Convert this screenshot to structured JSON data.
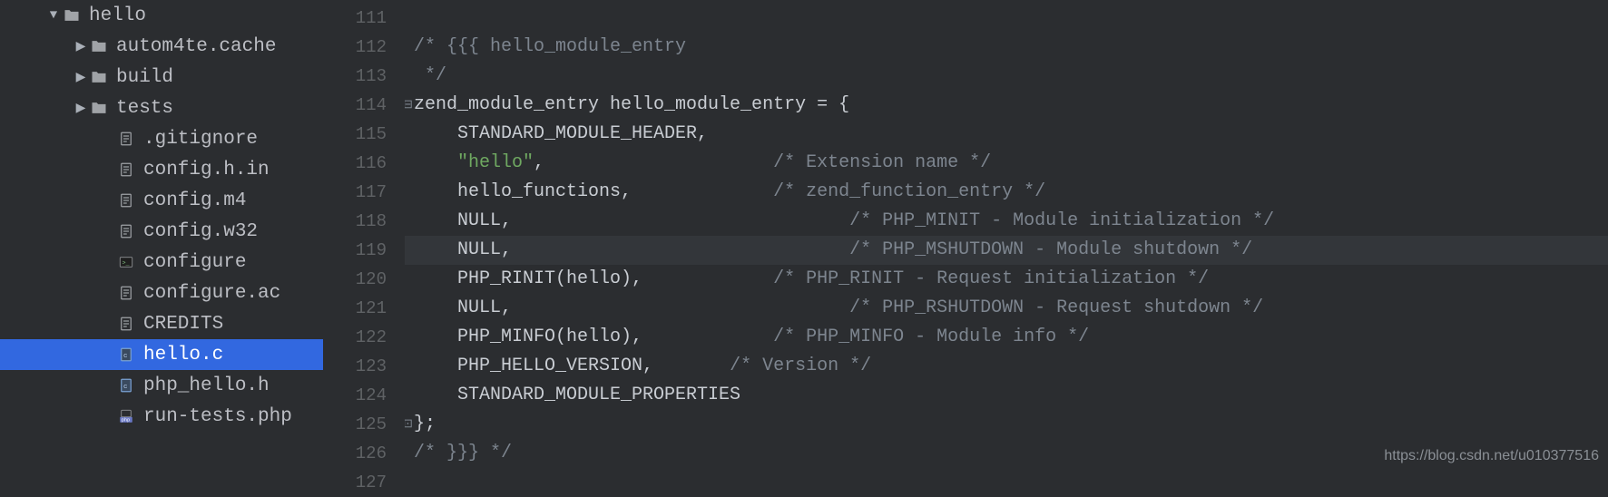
{
  "sidebar": {
    "items": [
      {
        "label": "hello",
        "depth": 1,
        "arrow": "down",
        "icon": "folder",
        "selected": false
      },
      {
        "label": "autom4te.cache",
        "depth": 2,
        "arrow": "right",
        "icon": "folder",
        "selected": false
      },
      {
        "label": "build",
        "depth": 2,
        "arrow": "right",
        "icon": "folder",
        "selected": false
      },
      {
        "label": "tests",
        "depth": 2,
        "arrow": "right",
        "icon": "folder",
        "selected": false
      },
      {
        "label": ".gitignore",
        "depth": 3,
        "arrow": "",
        "icon": "file",
        "selected": false
      },
      {
        "label": "config.h.in",
        "depth": 3,
        "arrow": "",
        "icon": "file",
        "selected": false
      },
      {
        "label": "config.m4",
        "depth": 3,
        "arrow": "",
        "icon": "file",
        "selected": false
      },
      {
        "label": "config.w32",
        "depth": 3,
        "arrow": "",
        "icon": "file",
        "selected": false
      },
      {
        "label": "configure",
        "depth": 3,
        "arrow": "",
        "icon": "term",
        "selected": false
      },
      {
        "label": "configure.ac",
        "depth": 3,
        "arrow": "",
        "icon": "file",
        "selected": false
      },
      {
        "label": "CREDITS",
        "depth": 3,
        "arrow": "",
        "icon": "file",
        "selected": false
      },
      {
        "label": "hello.c",
        "depth": 3,
        "arrow": "",
        "icon": "cfile",
        "selected": true
      },
      {
        "label": "php_hello.h",
        "depth": 3,
        "arrow": "",
        "icon": "cfile",
        "selected": false
      },
      {
        "label": "run-tests.php",
        "depth": 3,
        "arrow": "",
        "icon": "php",
        "selected": false
      }
    ]
  },
  "gutter": {
    "start": 111,
    "end": 127
  },
  "code": {
    "lines": [
      {
        "n": 111,
        "segs": []
      },
      {
        "n": 112,
        "segs": [
          {
            "t": "/* {{{ hello_module_entry",
            "cls": "c-comment"
          }
        ]
      },
      {
        "n": 113,
        "segs": [
          {
            "t": " */",
            "cls": "c-comment"
          }
        ]
      },
      {
        "n": 114,
        "fold": "open",
        "segs": [
          {
            "t": "zend_module_entry hello_module_entry = {",
            "cls": ""
          }
        ]
      },
      {
        "n": 115,
        "segs": [
          {
            "t": "    STANDARD_MODULE_HEADER,",
            "cls": ""
          }
        ]
      },
      {
        "n": 116,
        "segs": [
          {
            "t": "    ",
            "cls": ""
          },
          {
            "t": "\"hello\"",
            "cls": "c-string"
          },
          {
            "t": ",                     ",
            "cls": ""
          },
          {
            "t": "/* Extension name */",
            "cls": "c-comment"
          }
        ]
      },
      {
        "n": 117,
        "segs": [
          {
            "t": "    hello_functions,             ",
            "cls": ""
          },
          {
            "t": "/* zend_function_entry */",
            "cls": "c-comment"
          }
        ]
      },
      {
        "n": 118,
        "segs": [
          {
            "t": "    NULL,                               ",
            "cls": ""
          },
          {
            "t": "/* PHP_MINIT - Module initialization */",
            "cls": "c-comment"
          }
        ]
      },
      {
        "n": 119,
        "hl": true,
        "segs": [
          {
            "t": "    NULL,                               ",
            "cls": ""
          },
          {
            "t": "/* PHP_MSHUTDOWN - Module shutdown */",
            "cls": "c-comment"
          }
        ]
      },
      {
        "n": 120,
        "segs": [
          {
            "t": "    PHP_RINIT(hello),            ",
            "cls": ""
          },
          {
            "t": "/* PHP_RINIT - Request initialization */",
            "cls": "c-comment"
          }
        ]
      },
      {
        "n": 121,
        "segs": [
          {
            "t": "    NULL,                               ",
            "cls": ""
          },
          {
            "t": "/* PHP_RSHUTDOWN - Request shutdown */",
            "cls": "c-comment"
          }
        ]
      },
      {
        "n": 122,
        "segs": [
          {
            "t": "    PHP_MINFO(hello),            ",
            "cls": ""
          },
          {
            "t": "/* PHP_MINFO - Module info */",
            "cls": "c-comment"
          }
        ]
      },
      {
        "n": 123,
        "segs": [
          {
            "t": "    PHP_HELLO_VERSION,       ",
            "cls": ""
          },
          {
            "t": "/* Version */",
            "cls": "c-comment"
          }
        ]
      },
      {
        "n": 124,
        "segs": [
          {
            "t": "    STANDARD_MODULE_PROPERTIES",
            "cls": ""
          }
        ]
      },
      {
        "n": 125,
        "fold": "close",
        "segs": [
          {
            "t": "};",
            "cls": ""
          }
        ]
      },
      {
        "n": 126,
        "segs": [
          {
            "t": "/* }}} */",
            "cls": "c-comment"
          }
        ]
      },
      {
        "n": 127,
        "segs": []
      }
    ]
  },
  "watermark": "https://blog.csdn.net/u010377516"
}
